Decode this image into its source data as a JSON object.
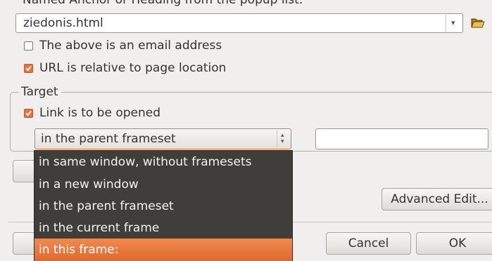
{
  "top_label": "Named Anchor or Heading from the popup list:",
  "url_field": {
    "value": "ziedonis.html",
    "arrow": "▾",
    "icon": "folder-open-icon"
  },
  "checkboxes": [
    {
      "label": "The above is an email address",
      "checked": false
    },
    {
      "label": "URL is relative to page location",
      "checked": true,
      "mnemonic": "r"
    }
  ],
  "target": {
    "legend": "Target",
    "open_checkbox": {
      "label": "Link is to be opened",
      "checked": true
    },
    "select_value": "in the parent frameset",
    "frame_name_value": ""
  },
  "dropdown": {
    "options": [
      "in same window, without framesets",
      "in a new window",
      "in the parent frameset",
      "in the current frame",
      "in this frame:"
    ],
    "highlighted_index": 4
  },
  "buttons": {
    "advanced_edit": "Advanced Edit...",
    "cancel": "Cancel",
    "ok": "OK"
  },
  "colors": {
    "accent": "#e8733c",
    "popup_bg": "#3f3e3b",
    "dialog_bg": "#f0efed"
  }
}
